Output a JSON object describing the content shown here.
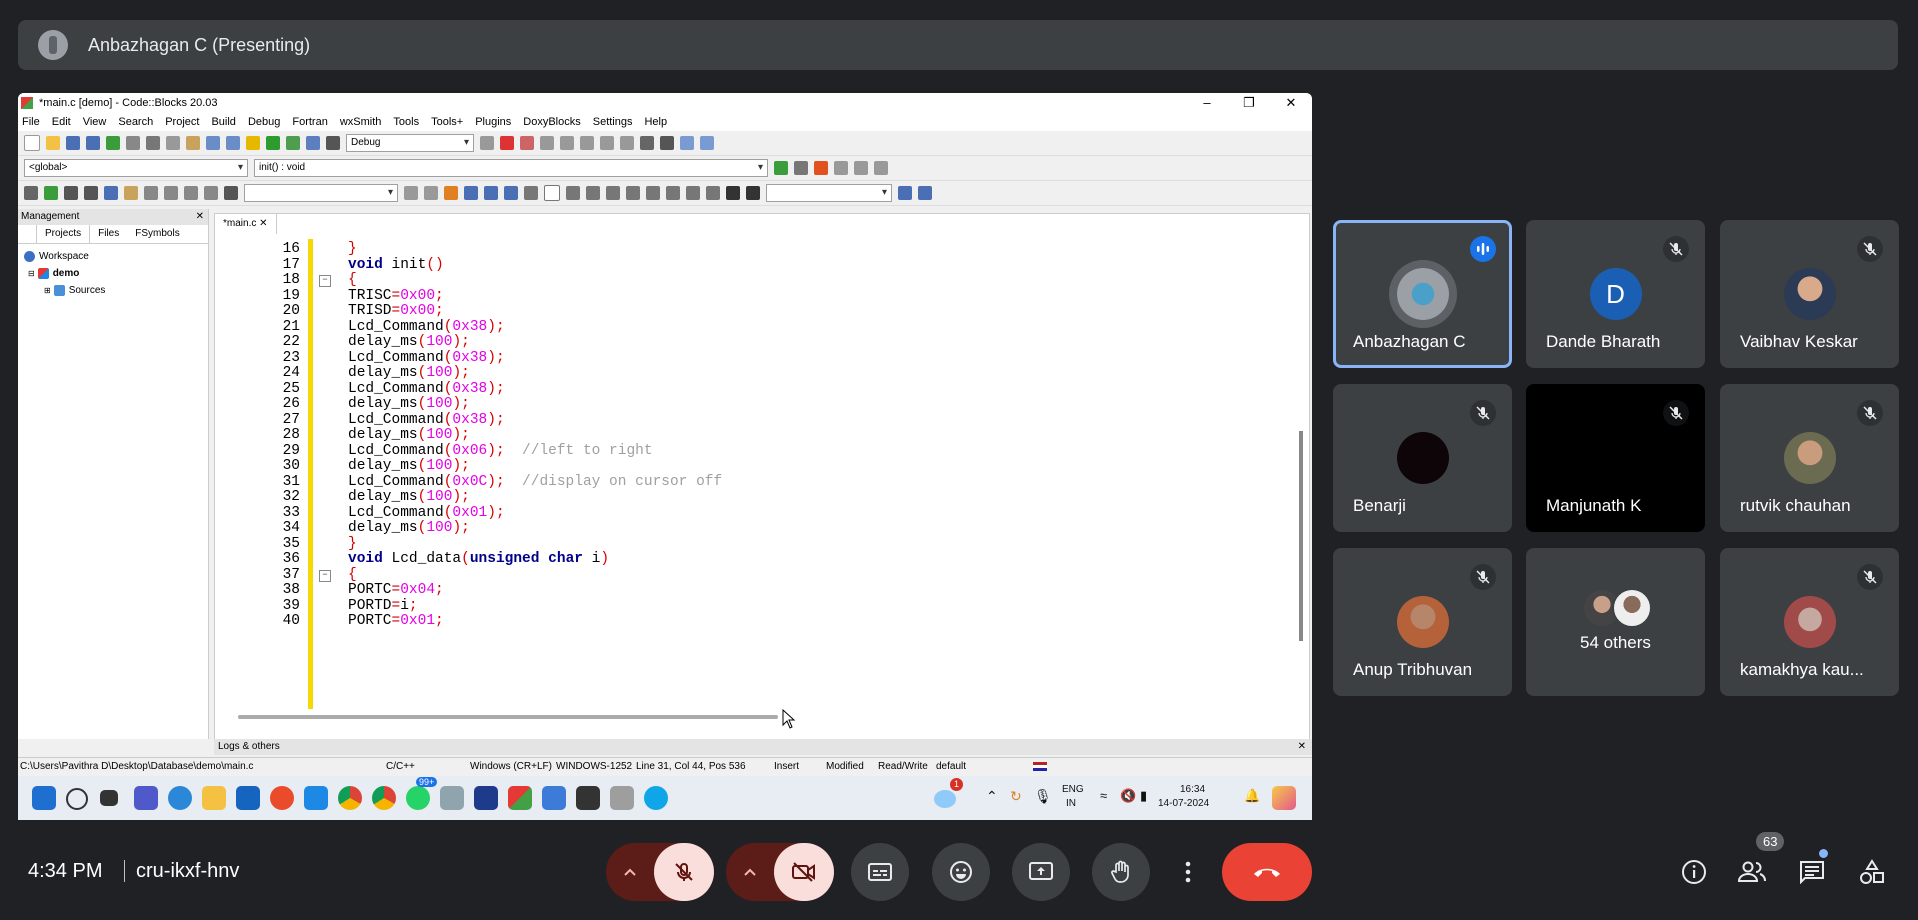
{
  "presenter_bar": {
    "name": "Anbazhagan C (Presenting)"
  },
  "screen": {
    "window_title": "*main.c [demo] - Code::Blocks 20.03",
    "menu": [
      "File",
      "Edit",
      "View",
      "Search",
      "Project",
      "Build",
      "Debug",
      "Fortran",
      "wxSmith",
      "Tools",
      "Tools+",
      "Plugins",
      "DoxyBlocks",
      "Settings",
      "Help"
    ],
    "build_target": "Debug",
    "scope": "<global>",
    "function": "init() : void",
    "management": {
      "title": "Management",
      "tabs": [
        "Projects",
        "Files",
        "FSymbols"
      ],
      "tree": [
        "Workspace",
        "demo",
        "Sources"
      ]
    },
    "editor_tab": "*main.c",
    "code_lines": [
      {
        "n": "16",
        "t": "}"
      },
      {
        "n": "17",
        "t": "void init()"
      },
      {
        "n": "18",
        "t": "{"
      },
      {
        "n": "19",
        "t": "TRISC=0x00;"
      },
      {
        "n": "20",
        "t": "TRISD=0x00;"
      },
      {
        "n": "21",
        "t": "Lcd_Command(0x38);"
      },
      {
        "n": "22",
        "t": "delay_ms(100);"
      },
      {
        "n": "23",
        "t": "Lcd_Command(0x38);"
      },
      {
        "n": "24",
        "t": "delay_ms(100);"
      },
      {
        "n": "25",
        "t": "Lcd_Command(0x38);"
      },
      {
        "n": "26",
        "t": "delay_ms(100);"
      },
      {
        "n": "27",
        "t": "Lcd_Command(0x38);"
      },
      {
        "n": "28",
        "t": "delay_ms(100);"
      },
      {
        "n": "29",
        "t": "Lcd_Command(0x06);  //left to right"
      },
      {
        "n": "30",
        "t": "delay_ms(100);"
      },
      {
        "n": "31",
        "t": "Lcd_Command(0x0C);  //display on cursor off"
      },
      {
        "n": "32",
        "t": "delay_ms(100);"
      },
      {
        "n": "33",
        "t": "Lcd_Command(0x01);"
      },
      {
        "n": "34",
        "t": "delay_ms(100);"
      },
      {
        "n": "35",
        "t": "}"
      },
      {
        "n": "36",
        "t": "void Lcd_data(unsigned char i)"
      },
      {
        "n": "37",
        "t": "{"
      },
      {
        "n": "38",
        "t": "PORTC=0x04;"
      },
      {
        "n": "39",
        "t": "PORTD=i;"
      },
      {
        "n": "40",
        "t": "PORTC=0x01;"
      }
    ],
    "logs_title": "Logs & others",
    "status": {
      "path": "C:\\Users\\Pavithra D\\Desktop\\Database\\demo\\main.c",
      "lang": "C/C++",
      "eol": "Windows (CR+LF)",
      "encoding": "WINDOWS-1252",
      "position": "Line 31, Col 44, Pos 536",
      "mode": "Insert",
      "modified": "Modified",
      "access": "Read/Write",
      "profile": "default"
    },
    "taskbar": {
      "weather_badge": "1",
      "whatsapp_badge": "99+",
      "lang_top": "ENG",
      "lang_bottom": "IN",
      "time": "16:34",
      "date": "14-07-2024"
    }
  },
  "participants": [
    {
      "name": "Anbazhagan C",
      "avatar": "photo",
      "active": true
    },
    {
      "name": "Dande Bharath",
      "avatar": "D"
    },
    {
      "name": "Vaibhav Keskar",
      "avatar": "photo"
    },
    {
      "name": "Benarji",
      "avatar": "photo"
    },
    {
      "name": "Manjunath K",
      "avatar": "none"
    },
    {
      "name": "rutvik chauhan",
      "avatar": "photo"
    },
    {
      "name": "Anup Tribhuvan",
      "avatar": "photo"
    },
    {
      "name": "54 others",
      "avatar": "group"
    },
    {
      "name": "kamakhya kau...",
      "avatar": "photo"
    }
  ],
  "meeting": {
    "time": "4:34 PM",
    "code": "cru-ikxf-hnv",
    "people_count": "63"
  },
  "colors": {
    "accent": "#8ab4f8",
    "end_call": "#ea4335",
    "tile_bg": "#3c4043"
  }
}
